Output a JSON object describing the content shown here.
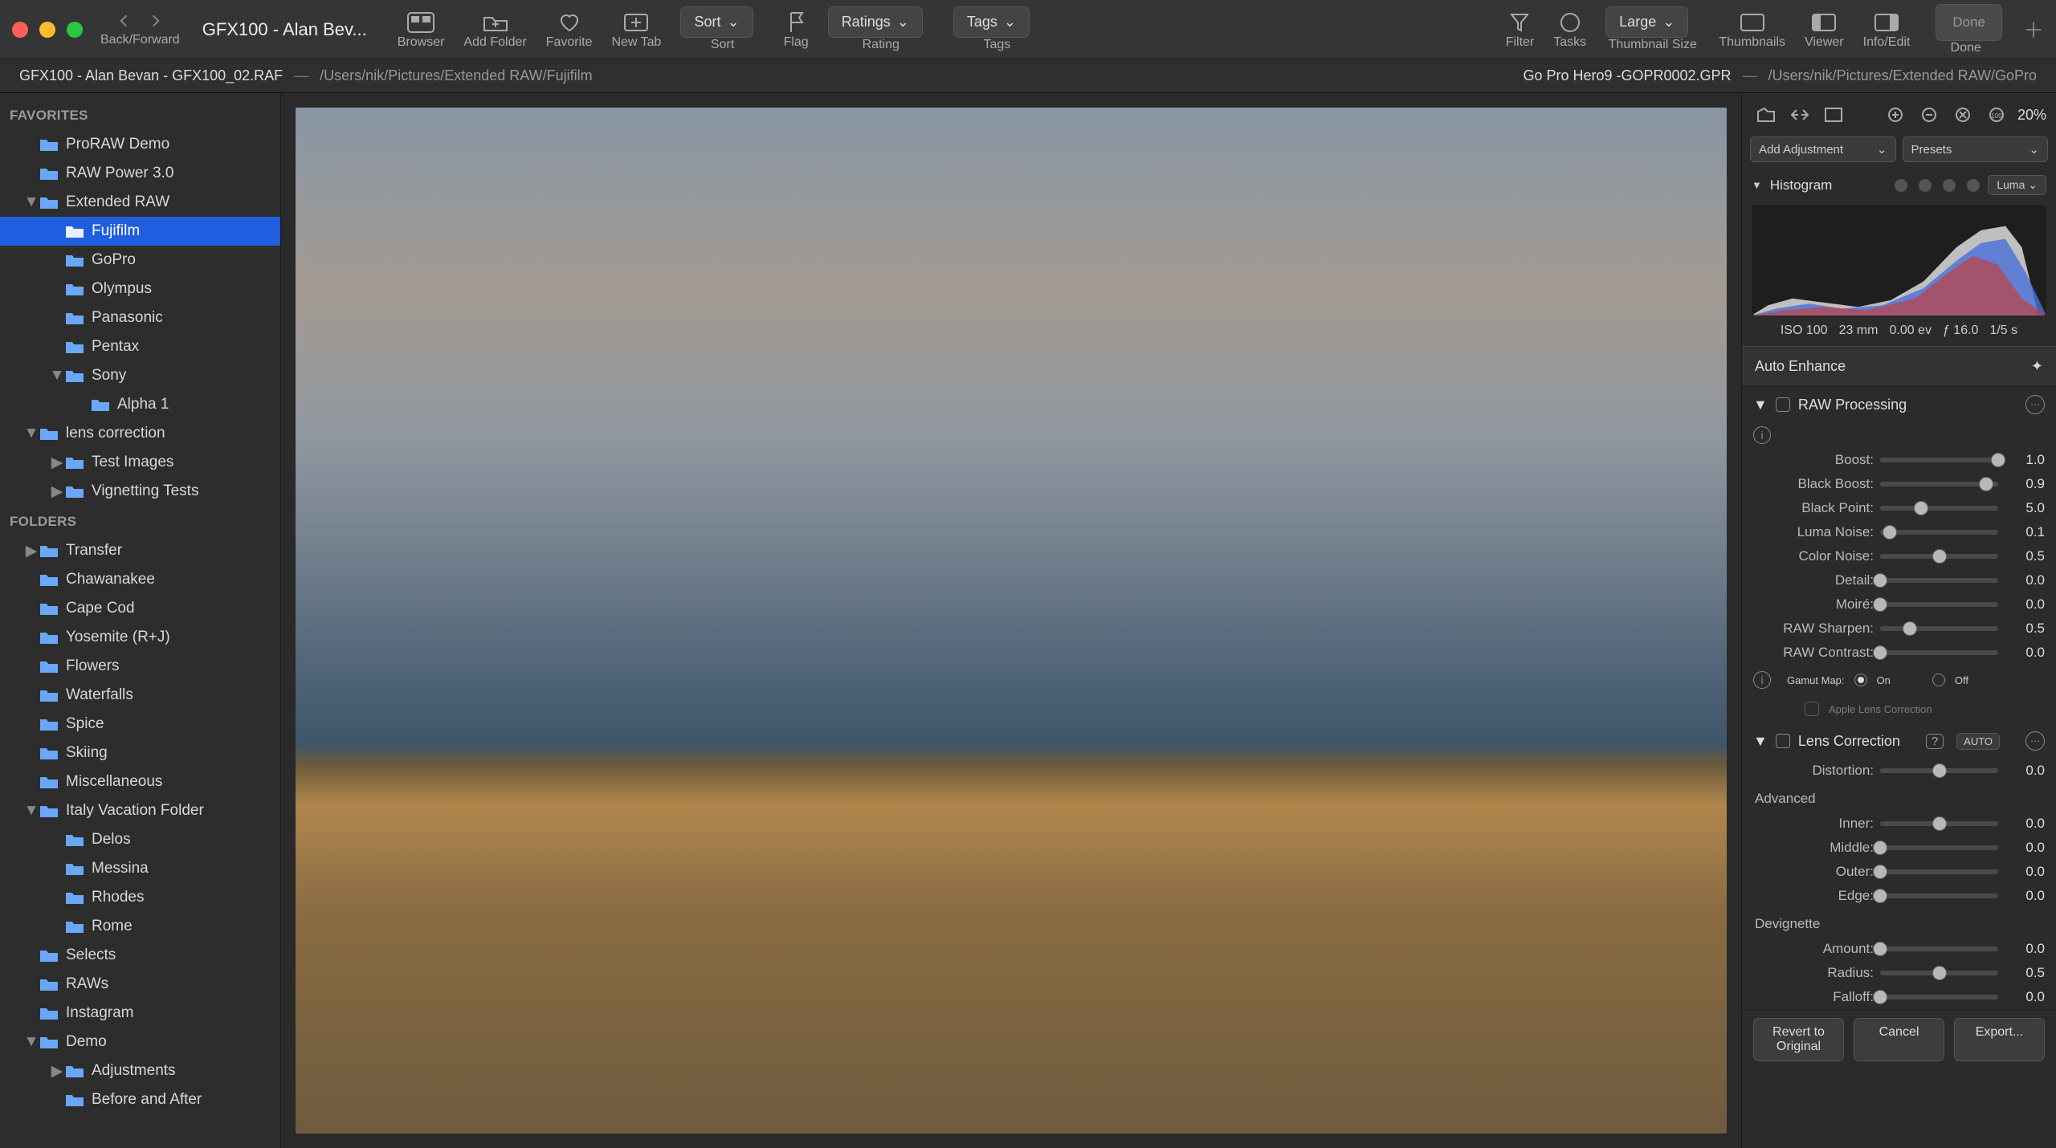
{
  "titlebar": {
    "back_forward_label": "Back/Forward",
    "title": "GFX100 - Alan Bev...",
    "browser_label": "Browser",
    "add_folder_label": "Add Folder",
    "favorite_label": "Favorite",
    "new_tab_label": "New Tab",
    "sort_pill": "Sort",
    "sort_label": "Sort",
    "flag_label": "Flag",
    "ratings_pill": "Ratings",
    "rating_label": "Rating",
    "tags_pill": "Tags",
    "tags_label": "Tags",
    "filter_label": "Filter",
    "tasks_label": "Tasks",
    "large_label": "Large",
    "thumb_size_label": "Thumbnail Size",
    "thumbnails_label": "Thumbnails",
    "viewer_label": "Viewer",
    "info_edit_label": "Info/Edit",
    "done_label": "Done"
  },
  "pathbar": {
    "left_file": "GFX100 - Alan Bevan - GFX100_02.RAF",
    "left_loc": "/Users/nik/Pictures/Extended RAW/Fujifilm",
    "sep": "—",
    "right_file": "Go Pro Hero9 -GOPR0002.GPR",
    "right_loc": "/Users/nik/Pictures/Extended RAW/GoPro"
  },
  "sidebar": {
    "favorites_hdr": "FAVORITES",
    "folders_hdr": "FOLDERS",
    "favorites": [
      {
        "label": "ProRAW Demo",
        "indent": 1
      },
      {
        "label": "RAW Power 3.0",
        "indent": 1
      },
      {
        "label": "Extended RAW",
        "indent": 1,
        "disclosure": "▼"
      },
      {
        "label": "Fujifilm",
        "indent": 2,
        "selected": true
      },
      {
        "label": "GoPro",
        "indent": 2
      },
      {
        "label": "Olympus",
        "indent": 2
      },
      {
        "label": "Panasonic",
        "indent": 2
      },
      {
        "label": "Pentax",
        "indent": 2
      },
      {
        "label": "Sony",
        "indent": 2,
        "disclosure": "▼"
      },
      {
        "label": "Alpha 1",
        "indent": 3
      },
      {
        "label": "lens correction",
        "indent": 1,
        "disclosure": "▼"
      },
      {
        "label": "Test Images",
        "indent": 2,
        "disclosure": "▶"
      },
      {
        "label": "Vignetting Tests",
        "indent": 2,
        "disclosure": "▶"
      }
    ],
    "folders": [
      {
        "label": "Transfer",
        "indent": 1,
        "disclosure": "▶"
      },
      {
        "label": "Chawanakee",
        "indent": 1
      },
      {
        "label": "Cape Cod",
        "indent": 1
      },
      {
        "label": "Yosemite (R+J)",
        "indent": 1
      },
      {
        "label": "Flowers",
        "indent": 1
      },
      {
        "label": "Waterfalls",
        "indent": 1
      },
      {
        "label": "Spice",
        "indent": 1
      },
      {
        "label": "Skiing",
        "indent": 1
      },
      {
        "label": "Miscellaneous",
        "indent": 1
      },
      {
        "label": "Italy Vacation Folder",
        "indent": 1,
        "disclosure": "▼"
      },
      {
        "label": "Delos",
        "indent": 2
      },
      {
        "label": "Messina",
        "indent": 2
      },
      {
        "label": "Rhodes",
        "indent": 2
      },
      {
        "label": "Rome",
        "indent": 2
      },
      {
        "label": "Selects",
        "indent": 1
      },
      {
        "label": "RAWs",
        "indent": 1
      },
      {
        "label": "Instagram",
        "indent": 1
      },
      {
        "label": "Demo",
        "indent": 1,
        "disclosure": "▼"
      },
      {
        "label": "Adjustments",
        "indent": 2,
        "disclosure": "▶"
      },
      {
        "label": "Before and After",
        "indent": 2
      }
    ]
  },
  "panel": {
    "zoom_pct": "20%",
    "add_adjustment": "Add Adjustment",
    "presets": "Presets",
    "histogram_label": "Histogram",
    "luma_label": "Luma",
    "exif": {
      "iso": "ISO 100",
      "focal": "23 mm",
      "ev": "0.00 ev",
      "fstop": "ƒ 16.0",
      "shutter": "1/5 s"
    },
    "auto_enhance": "Auto Enhance",
    "raw_processing": {
      "title": "RAW Processing",
      "sliders": [
        {
          "label": "Boost:",
          "value": "1.0",
          "pos": 100
        },
        {
          "label": "Black Boost:",
          "value": "0.9",
          "pos": 90
        },
        {
          "label": "Black Point:",
          "value": "5.0",
          "pos": 35
        },
        {
          "label": "Luma Noise:",
          "value": "0.1",
          "pos": 8
        },
        {
          "label": "Color Noise:",
          "value": "0.5",
          "pos": 50
        },
        {
          "label": "Detail:",
          "value": "0.0",
          "pos": 0
        },
        {
          "label": "Moiré:",
          "value": "0.0",
          "pos": 0
        },
        {
          "label": "RAW Sharpen:",
          "value": "0.5",
          "pos": 25
        },
        {
          "label": "RAW Contrast:",
          "value": "0.0",
          "pos": 0
        }
      ],
      "gamut_label": "Gamut Map:",
      "gamut_on": "On",
      "gamut_off": "Off",
      "apple_lens": "Apple Lens Correction"
    },
    "lens_correction": {
      "title": "Lens Correction",
      "auto_badge": "AUTO",
      "sliders_top": [
        {
          "label": "Distortion:",
          "value": "0.0",
          "pos": 50
        }
      ],
      "advanced_label": "Advanced",
      "sliders_adv": [
        {
          "label": "Inner:",
          "value": "0.0",
          "pos": 50
        },
        {
          "label": "Middle:",
          "value": "0.0",
          "pos": 0
        },
        {
          "label": "Outer:",
          "value": "0.0",
          "pos": 0
        },
        {
          "label": "Edge:",
          "value": "0.0",
          "pos": 0
        }
      ],
      "devignette_label": "Devignette",
      "sliders_dev": [
        {
          "label": "Amount:",
          "value": "0.0",
          "pos": 0
        },
        {
          "label": "Radius:",
          "value": "0.5",
          "pos": 50
        },
        {
          "label": "Falloff:",
          "value": "0.0",
          "pos": 0
        }
      ]
    },
    "footer": {
      "revert": "Revert to Original",
      "cancel": "Cancel",
      "export": "Export..."
    }
  }
}
